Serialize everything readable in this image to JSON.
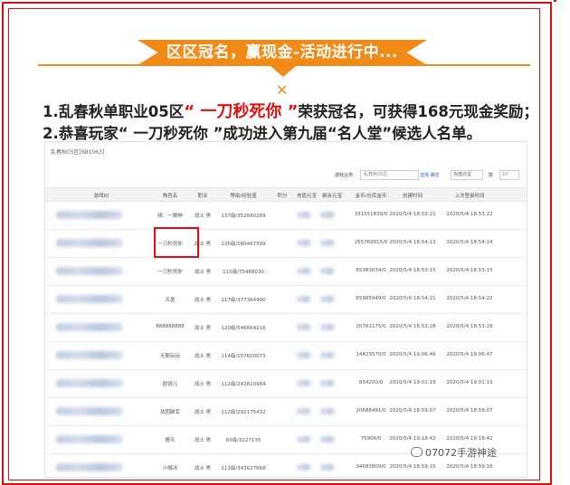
{
  "banner": {
    "title": "区区冠名，赢现金-活动进行中..."
  },
  "announcement": {
    "line1_prefix": "1.乱春秋单职业05区",
    "line1_name": "“ 一刀秒死你 ”",
    "line1_suffix": "荣获冠名，可获得168元现金奖励；",
    "line2": "2.恭喜玩家“ 一刀秒死你 ”成功进入第九届“名人堂”候选人名单。"
  },
  "screenshot": {
    "title": "乱春秋05区[681063]",
    "toolbar": {
      "search_label": "游戏业务:",
      "search_value": "乱春秋05区",
      "buttons": "选择 确定",
      "select_value": "充值元宝",
      "page_label": "款",
      "page_value": "10"
    },
    "columns": [
      "游戏ID",
      "角色名",
      "职业",
      "等级/经验值",
      "积分",
      "充值元宝",
      "剩余元宝",
      "金币/仓库金币",
      "创建时间",
      "上次登录时间"
    ],
    "rows": [
      {
        "name": "晴、一眼神",
        "job": "战士 男",
        "level": "137级/352680289",
        "gold": "331551839/0",
        "created": "2020/5/4 18:53:21",
        "login": "2020/5/4 18:53:22"
      },
      {
        "name": "一刀秒死你",
        "job": "战士 男",
        "level": "135级/180467509",
        "gold": "255769815/0",
        "created": "2020/5/4 18:54:13",
        "login": "2020/5/4 18:54:14"
      },
      {
        "name": "一刀秒死你",
        "job": "战士 男",
        "level": "115级/75488030",
        "gold": "65383634/0",
        "created": "2020/5/4 18:53:15",
        "login": "2020/5/4 18:53:15"
      },
      {
        "name": "天墨",
        "job": "战士 男",
        "level": "117级/377364490",
        "gold": "65985949/0",
        "created": "2020/5/4 18:54:21",
        "login": "2020/5/4 18:54:22"
      },
      {
        "name": "888888888",
        "job": "战士 男",
        "level": "120级/546664216",
        "gold": "20761175/0",
        "created": "2020/5/4 18:53:28",
        "login": "2020/5/4 18:53:28"
      },
      {
        "name": "无聊玩玩",
        "job": "战士 男",
        "level": "114级/157600073",
        "gold": "14423570/0",
        "created": "2020/5/4 19:06:46",
        "login": "2020/5/4 19:06:47"
      },
      {
        "name": "欧锐儿",
        "job": "战士 男",
        "level": "112级/242810984",
        "gold": "834200/0",
        "created": "2020/5/4 19:01:19",
        "login": "2020/5/4 19:01:19"
      },
      {
        "name": "战团破军",
        "job": "战士 男",
        "level": "112级/292175432",
        "gold": "20688491/0",
        "created": "2020/5/4 18:59:07",
        "login": "2020/5/4 18:59:07"
      },
      {
        "name": "傲天",
        "job": "战士 男",
        "level": "83级/3227135",
        "gold": "75906/0",
        "created": "2020/5/4 19:18:42",
        "login": "2020/5/4 19:18:42"
      },
      {
        "name": "小帽冰",
        "job": "战士 男",
        "level": "112级/343627668",
        "gold": "34683809/0",
        "created": "2020/5/4 18:59:15",
        "login": "2020/5/4 18:59:16"
      }
    ]
  },
  "watermark": "07072手游神途",
  "colors": {
    "accent": "#f18a16",
    "frame": "#d41010",
    "highlight": "#e01010"
  }
}
